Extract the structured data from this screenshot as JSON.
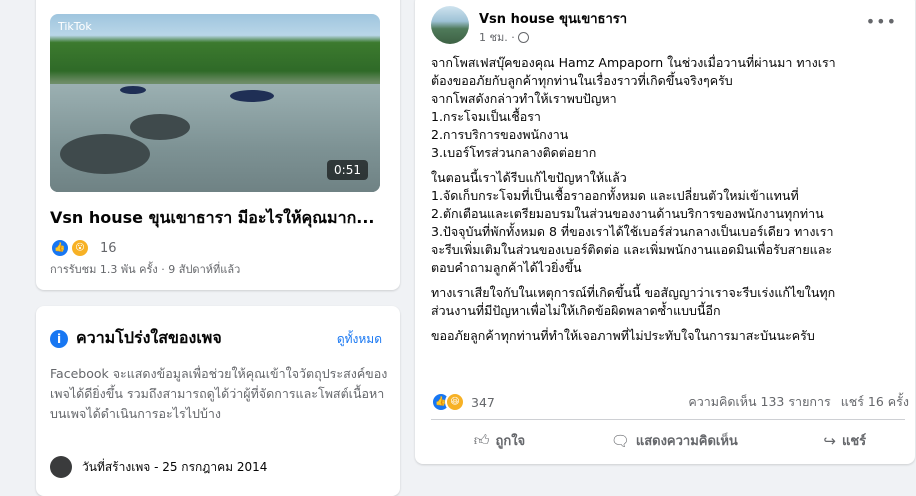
{
  "video_card": {
    "watermark": "TikTok",
    "duration": "0:51",
    "title": "Vsn house ขุนเขาธารา มีอะไรให้คุณมาก...",
    "reaction_count": "16",
    "views": "การรับชม 1.3 พัน ครั้ง · 9 สัปดาห์ที่แล้ว"
  },
  "transparency": {
    "title": "ความโปร่งใสของเพจ",
    "see_all": "ดูทั้งหมด",
    "body": "Facebook จะแสดงข้อมูลเพื่อช่วยให้คุณเข้าใจวัตถุประสงค์ของเพจได้ดียิ่งขึ้น รวมถึงสามารถดูได้ว่าผู้ที่จัดการและโพสต์เนื้อหาบนเพจได้ดำเนินการอะไรไปบ้าง",
    "partial_row": "วันที่สร้างเพจ - 25 กรกฎาคม 2014"
  },
  "post": {
    "page_name": "Vsn house ขุนเขาธารา",
    "time": "1 ชม. ·",
    "paragraphs": [
      [
        "จากโพสเฟสบุ๊คของคุณ Hamz Ampaporn ในช่วงเมื่อวานที่ผ่านมา ทางเรา",
        "ต้องขออภัยกับลูกค้าทุกท่านในเรื่องราวที่เกิดขึ้นจริงๆครับ",
        "จากโพสดังกล่าวทำให้เราพบปัญหา",
        "1.กระโจมเป็นเชื้อรา",
        "2.การบริการของพนักงาน",
        "3.เบอร์โทรส่วนกลางติดต่อยาก"
      ],
      [
        "ในตอนนี้เราได้รีบแก้ไขปัญหาให้แล้ว",
        "1.จัดเก็บกระโจมที่เป็นเชื้อราออกทั้งหมด และเปลี่ยนตัวใหม่เข้าแทนที่",
        "2.ตักเตือนและเตรียมอบรมในส่วนของงานด้านบริการของพนักงานทุกท่าน",
        "3.ปัจจุบันที่พักทั้งหมด 8 ที่ของเราได้ใช้เบอร์ส่วนกลางเป็นเบอร์เดียว ทางเรา",
        "จะรีบเพิ่มเติมในส่วนของเบอร์ติดต่อ และเพิ่มพนักงานแอดมินเพื่อรับสายและ",
        "ตอบคำถามลูกค้าได้ไวยิ่งขึ้น"
      ],
      [
        "ทางเราเสียใจกับในเหตุการณ์ที่เกิดขึ้นนี้ ขอสัญญาว่าเราจะรีบเร่งแก้ไขในทุก",
        "ส่วนงานที่มีปัญหาเพื่อไม่ให้เกิดข้อผิดพลาดซ้ำแบบนี้อีก"
      ],
      [
        "ขออภัยลูกค้าทุกท่านที่ทำให้เจอภาพที่ไม่ประทับใจในการมาสะบันนะครับ"
      ]
    ],
    "reaction_count": "347",
    "comments": "ความคิดเห็น 133 รายการ",
    "shares": "แชร์ 16 ครั้ง",
    "like_label": "ถูกใจ",
    "comment_label": "แสดงความคิดเห็น",
    "share_label": "แชร์"
  }
}
